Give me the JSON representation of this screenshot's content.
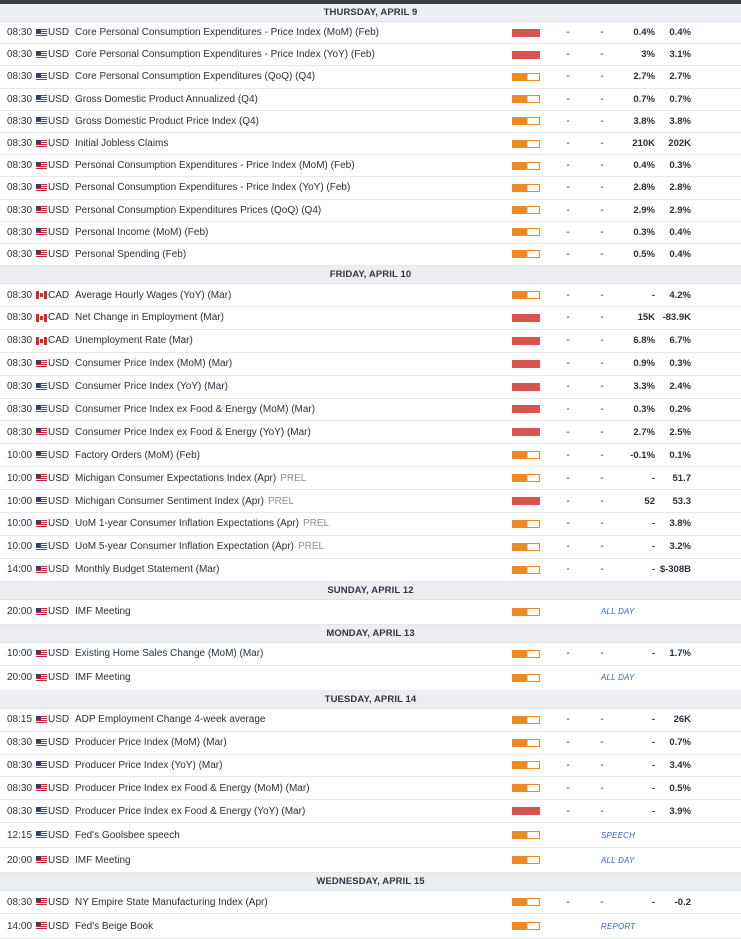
{
  "days": [
    {
      "label": "THURSDAY, APRIL 9",
      "events": [
        {
          "time": "08:30",
          "flag": "us",
          "currency": "USD",
          "name": "Core Personal Consumption Expenditures - Price Index (MoM) (Feb)",
          "tag_suffix": "",
          "impact": "high",
          "actual": "-",
          "consensus": "-",
          "forecast": "0.4%",
          "previous": "0.4%",
          "special": ""
        },
        {
          "time": "08:30",
          "flag": "us",
          "currency": "USD",
          "name": "Core Personal Consumption Expenditures - Price Index (YoY) (Feb)",
          "tag_suffix": "",
          "impact": "high",
          "actual": "-",
          "consensus": "-",
          "forecast": "3%",
          "previous": "3.1%",
          "special": ""
        },
        {
          "time": "08:30",
          "flag": "us",
          "currency": "USD",
          "name": "Core Personal Consumption Expenditures (QoQ) (Q4)",
          "tag_suffix": "",
          "impact": "medium",
          "actual": "-",
          "consensus": "-",
          "forecast": "2.7%",
          "previous": "2.7%",
          "special": ""
        },
        {
          "time": "08:30",
          "flag": "us",
          "currency": "USD",
          "name": "Gross Domestic Product Annualized (Q4)",
          "tag_suffix": "",
          "impact": "medium",
          "actual": "-",
          "consensus": "-",
          "forecast": "0.7%",
          "previous": "0.7%",
          "special": ""
        },
        {
          "time": "08:30",
          "flag": "us",
          "currency": "USD",
          "name": "Gross Domestic Product Price Index (Q4)",
          "tag_suffix": "",
          "impact": "medium",
          "actual": "-",
          "consensus": "-",
          "forecast": "3.8%",
          "previous": "3.8%",
          "special": ""
        },
        {
          "time": "08:30",
          "flag": "us",
          "currency": "USD",
          "name": "Initial Jobless Claims",
          "tag_suffix": "",
          "impact": "medium",
          "actual": "-",
          "consensus": "-",
          "forecast": "210K",
          "previous": "202K",
          "special": ""
        },
        {
          "time": "08:30",
          "flag": "us",
          "currency": "USD",
          "name": "Personal Consumption Expenditures - Price Index (MoM) (Feb)",
          "tag_suffix": "",
          "impact": "medium",
          "actual": "-",
          "consensus": "-",
          "forecast": "0.4%",
          "previous": "0.3%",
          "special": ""
        },
        {
          "time": "08:30",
          "flag": "us",
          "currency": "USD",
          "name": "Personal Consumption Expenditures - Price Index (YoY) (Feb)",
          "tag_suffix": "",
          "impact": "medium",
          "actual": "-",
          "consensus": "-",
          "forecast": "2.8%",
          "previous": "2.8%",
          "special": ""
        },
        {
          "time": "08:30",
          "flag": "us",
          "currency": "USD",
          "name": "Personal Consumption Expenditures Prices (QoQ) (Q4)",
          "tag_suffix": "",
          "impact": "medium",
          "actual": "-",
          "consensus": "-",
          "forecast": "2.9%",
          "previous": "2.9%",
          "special": ""
        },
        {
          "time": "08:30",
          "flag": "us",
          "currency": "USD",
          "name": "Personal Income (MoM) (Feb)",
          "tag_suffix": "",
          "impact": "medium",
          "actual": "-",
          "consensus": "-",
          "forecast": "0.3%",
          "previous": "0.4%",
          "special": ""
        },
        {
          "time": "08:30",
          "flag": "us",
          "currency": "USD",
          "name": "Personal Spending (Feb)",
          "tag_suffix": "",
          "impact": "medium",
          "actual": "-",
          "consensus": "-",
          "forecast": "0.5%",
          "previous": "0.4%",
          "special": ""
        }
      ]
    },
    {
      "label": "FRIDAY, APRIL 10",
      "events": [
        {
          "time": "08:30",
          "flag": "ca",
          "currency": "CAD",
          "name": "Average Hourly Wages (YoY) (Mar)",
          "tag_suffix": "",
          "impact": "medium",
          "actual": "-",
          "consensus": "-",
          "forecast": "-",
          "previous": "4.2%",
          "special": ""
        },
        {
          "time": "08:30",
          "flag": "ca",
          "currency": "CAD",
          "name": "Net Change in Employment (Mar)",
          "tag_suffix": "",
          "impact": "high",
          "actual": "-",
          "consensus": "-",
          "forecast": "15K",
          "previous": "-83.9K",
          "special": ""
        },
        {
          "time": "08:30",
          "flag": "ca",
          "currency": "CAD",
          "name": "Unemployment Rate (Mar)",
          "tag_suffix": "",
          "impact": "high",
          "actual": "-",
          "consensus": "-",
          "forecast": "6.8%",
          "previous": "6.7%",
          "special": ""
        },
        {
          "time": "08:30",
          "flag": "us",
          "currency": "USD",
          "name": "Consumer Price Index (MoM) (Mar)",
          "tag_suffix": "",
          "impact": "high",
          "actual": "-",
          "consensus": "-",
          "forecast": "0.9%",
          "previous": "0.3%",
          "special": ""
        },
        {
          "time": "08:30",
          "flag": "us",
          "currency": "USD",
          "name": "Consumer Price Index (YoY) (Mar)",
          "tag_suffix": "",
          "impact": "high",
          "actual": "-",
          "consensus": "-",
          "forecast": "3.3%",
          "previous": "2.4%",
          "special": ""
        },
        {
          "time": "08:30",
          "flag": "us",
          "currency": "USD",
          "name": "Consumer Price Index ex Food & Energy (MoM) (Mar)",
          "tag_suffix": "",
          "impact": "high",
          "actual": "-",
          "consensus": "-",
          "forecast": "0.3%",
          "previous": "0.2%",
          "special": ""
        },
        {
          "time": "08:30",
          "flag": "us",
          "currency": "USD",
          "name": "Consumer Price Index ex Food & Energy (YoY) (Mar)",
          "tag_suffix": "",
          "impact": "high",
          "actual": "-",
          "consensus": "-",
          "forecast": "2.7%",
          "previous": "2.5%",
          "special": ""
        },
        {
          "time": "10:00",
          "flag": "us",
          "currency": "USD",
          "name": "Factory Orders (MoM) (Feb)",
          "tag_suffix": "",
          "impact": "medium",
          "actual": "-",
          "consensus": "-",
          "forecast": "-0.1%",
          "previous": "0.1%",
          "special": ""
        },
        {
          "time": "10:00",
          "flag": "us",
          "currency": "USD",
          "name": "Michigan Consumer Expectations Index (Apr)",
          "tag_suffix": "PREL",
          "impact": "medium",
          "actual": "-",
          "consensus": "-",
          "forecast": "-",
          "previous": "51.7",
          "special": ""
        },
        {
          "time": "10:00",
          "flag": "us",
          "currency": "USD",
          "name": "Michigan Consumer Sentiment Index (Apr)",
          "tag_suffix": "PREL",
          "impact": "high",
          "actual": "-",
          "consensus": "-",
          "forecast": "52",
          "previous": "53.3",
          "special": ""
        },
        {
          "time": "10:00",
          "flag": "us",
          "currency": "USD",
          "name": "UoM 1-year Consumer Inflation Expectations (Apr)",
          "tag_suffix": "PREL",
          "impact": "medium",
          "actual": "-",
          "consensus": "-",
          "forecast": "-",
          "previous": "3.8%",
          "special": ""
        },
        {
          "time": "10:00",
          "flag": "us",
          "currency": "USD",
          "name": "UoM 5-year Consumer Inflation Expectation (Apr)",
          "tag_suffix": "PREL",
          "impact": "medium",
          "actual": "-",
          "consensus": "-",
          "forecast": "-",
          "previous": "3.2%",
          "special": ""
        },
        {
          "time": "14:00",
          "flag": "us",
          "currency": "USD",
          "name": "Monthly Budget Statement (Mar)",
          "tag_suffix": "",
          "impact": "medium",
          "actual": "-",
          "consensus": "-",
          "forecast": "-",
          "previous": "$-308B",
          "special": ""
        }
      ]
    },
    {
      "label": "SUNDAY, APRIL 12",
      "events": [
        {
          "time": "20:00",
          "flag": "us",
          "currency": "USD",
          "name": "IMF Meeting",
          "tag_suffix": "",
          "impact": "medium",
          "actual": "",
          "consensus": "",
          "forecast": "",
          "previous": "",
          "special": "ALL DAY"
        }
      ]
    },
    {
      "label": "MONDAY, APRIL 13",
      "events": [
        {
          "time": "10:00",
          "flag": "us",
          "currency": "USD",
          "name": "Existing Home Sales Change (MoM) (Mar)",
          "tag_suffix": "",
          "impact": "medium",
          "actual": "-",
          "consensus": "-",
          "forecast": "-",
          "previous": "1.7%",
          "special": ""
        },
        {
          "time": "20:00",
          "flag": "us",
          "currency": "USD",
          "name": "IMF Meeting",
          "tag_suffix": "",
          "impact": "medium",
          "actual": "",
          "consensus": "",
          "forecast": "",
          "previous": "",
          "special": "ALL DAY"
        }
      ]
    },
    {
      "label": "TUESDAY, APRIL 14",
      "events": [
        {
          "time": "08:15",
          "flag": "us",
          "currency": "USD",
          "name": "ADP Employment Change 4-week average",
          "tag_suffix": "",
          "impact": "medium",
          "actual": "-",
          "consensus": "-",
          "forecast": "-",
          "previous": "26K",
          "special": ""
        },
        {
          "time": "08:30",
          "flag": "us",
          "currency": "USD",
          "name": "Producer Price Index (MoM) (Mar)",
          "tag_suffix": "",
          "impact": "medium",
          "actual": "-",
          "consensus": "-",
          "forecast": "-",
          "previous": "0.7%",
          "special": ""
        },
        {
          "time": "08:30",
          "flag": "us",
          "currency": "USD",
          "name": "Producer Price Index (YoY) (Mar)",
          "tag_suffix": "",
          "impact": "medium",
          "actual": "-",
          "consensus": "-",
          "forecast": "-",
          "previous": "3.4%",
          "special": ""
        },
        {
          "time": "08:30",
          "flag": "us",
          "currency": "USD",
          "name": "Producer Price Index ex Food & Energy (MoM) (Mar)",
          "tag_suffix": "",
          "impact": "medium",
          "actual": "-",
          "consensus": "-",
          "forecast": "-",
          "previous": "0.5%",
          "special": ""
        },
        {
          "time": "08:30",
          "flag": "us",
          "currency": "USD",
          "name": "Producer Price Index ex Food & Energy (YoY) (Mar)",
          "tag_suffix": "",
          "impact": "high",
          "actual": "-",
          "consensus": "-",
          "forecast": "-",
          "previous": "3.9%",
          "special": ""
        },
        {
          "time": "12:15",
          "flag": "us",
          "currency": "USD",
          "name": "Fed's Goolsbee speech",
          "tag_suffix": "",
          "impact": "medium",
          "actual": "",
          "consensus": "",
          "forecast": "",
          "previous": "",
          "special": "SPEECH"
        },
        {
          "time": "20:00",
          "flag": "us",
          "currency": "USD",
          "name": "IMF Meeting",
          "tag_suffix": "",
          "impact": "medium",
          "actual": "",
          "consensus": "",
          "forecast": "",
          "previous": "",
          "special": "ALL DAY"
        }
      ]
    },
    {
      "label": "WEDNESDAY, APRIL 15",
      "events": [
        {
          "time": "08:30",
          "flag": "us",
          "currency": "USD",
          "name": "NY Empire State Manufacturing Index (Apr)",
          "tag_suffix": "",
          "impact": "medium",
          "actual": "-",
          "consensus": "-",
          "forecast": "-",
          "previous": "-0.2",
          "special": ""
        },
        {
          "time": "14:00",
          "flag": "us",
          "currency": "USD",
          "name": "Fed's Beige Book",
          "tag_suffix": "",
          "impact": "medium",
          "actual": "",
          "consensus": "",
          "forecast": "",
          "previous": "",
          "special": "REPORT"
        }
      ]
    }
  ]
}
